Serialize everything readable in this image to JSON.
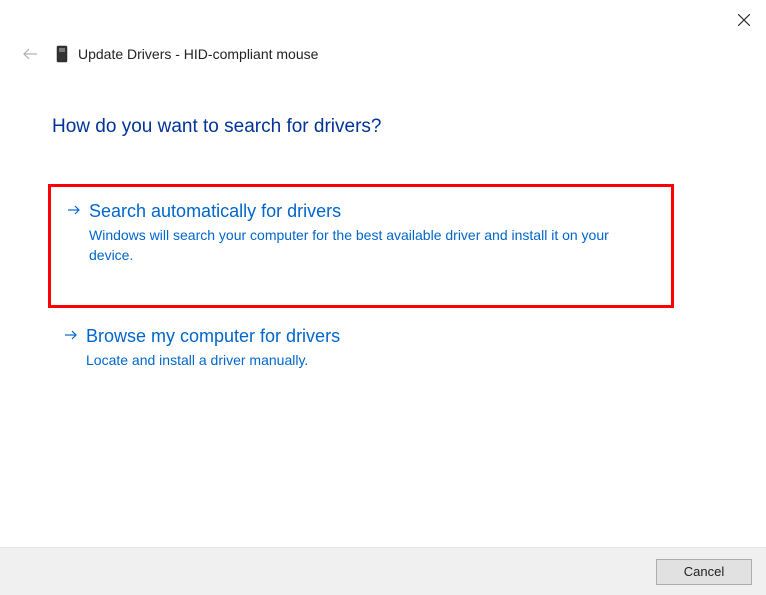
{
  "titlebar": {
    "close_label": "Close"
  },
  "header": {
    "back_label": "Back",
    "device_icon": "device-icon",
    "title": "Update Drivers - HID-compliant mouse"
  },
  "heading": "How do you want to search for drivers?",
  "options": [
    {
      "title": "Search automatically for drivers",
      "description": "Windows will search your computer for the best available driver and install it on your device.",
      "highlighted": true
    },
    {
      "title": "Browse my computer for drivers",
      "description": "Locate and install a driver manually.",
      "highlighted": false
    }
  ],
  "footer": {
    "cancel_label": "Cancel"
  },
  "colors": {
    "link": "#0066cc",
    "heading": "#003399",
    "highlight_border": "#ff0000"
  }
}
